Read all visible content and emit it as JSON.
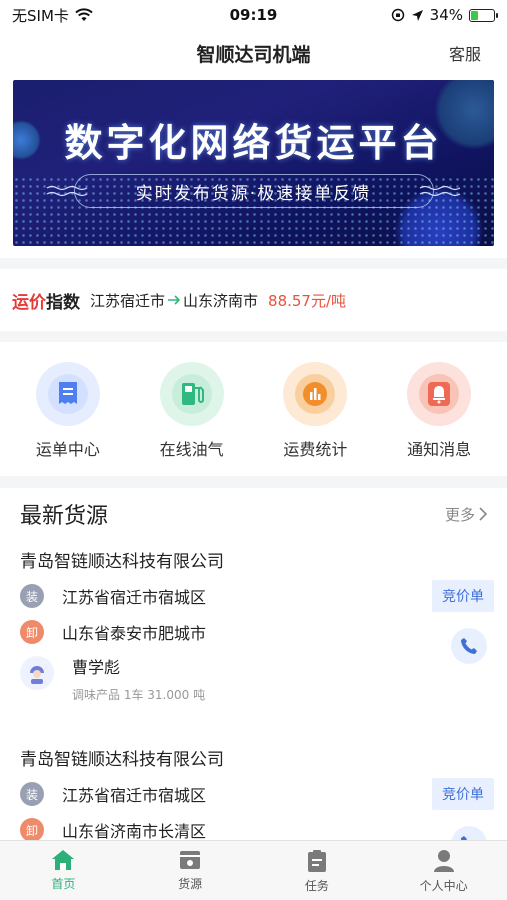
{
  "status_bar": {
    "carrier": "无SIM卡",
    "time": "09:19",
    "battery_percent": "34%",
    "battery_level": 0.34
  },
  "nav": {
    "title": "智顺达司机端",
    "service_label": "客服"
  },
  "banner": {
    "title": "数字化网络货运平台",
    "subtitle": "实时发布货源·极速接单反馈"
  },
  "price_index": {
    "logo_red": "运价",
    "logo_dark": "指数",
    "from": "江苏宿迁市",
    "to": "山东济南市",
    "price": "88.57元/吨"
  },
  "menu": {
    "items": [
      {
        "label": "运单中心",
        "icon": "waybill-icon",
        "color": "#4f7ef0",
        "bg": "#e6edff"
      },
      {
        "label": "在线油气",
        "icon": "fuel-pump-icon",
        "color": "#2fb880",
        "bg": "#dff5ea"
      },
      {
        "label": "运费统计",
        "icon": "bar-chart-icon",
        "color": "#f28e2b",
        "bg": "#fde9d4"
      },
      {
        "label": "通知消息",
        "icon": "bell-icon",
        "color": "#ee6a55",
        "bg": "#fde1dc"
      }
    ]
  },
  "latest": {
    "title": "最新货源",
    "more_label": "更多",
    "cargo": [
      {
        "company": "青岛智链顺达科技有限公司",
        "load_tag": "装",
        "load_addr": "江苏省宿迁市宿城区",
        "unload_tag": "卸",
        "unload_addr": "山东省泰安市肥城市",
        "badge": "竞价单",
        "contact": "曹学彪",
        "meta": "调味产品 1车 31.000 吨"
      },
      {
        "company": "青岛智链顺达科技有限公司",
        "load_tag": "装",
        "load_addr": "江苏省宿迁市宿城区",
        "unload_tag": "卸",
        "unload_addr": "山东省济南市长清区",
        "badge": "竞价单"
      }
    ]
  },
  "tabs": [
    {
      "label": "首页",
      "icon": "home-icon",
      "active": true
    },
    {
      "label": "货源",
      "icon": "cargo-icon",
      "active": false
    },
    {
      "label": "任务",
      "icon": "task-clipboard-icon",
      "active": false
    },
    {
      "label": "个人中心",
      "icon": "user-icon",
      "active": false
    }
  ],
  "colors": {
    "accent_green": "#2bb07a",
    "price_red": "#e6533b",
    "bid_blue": "#3f6fd8"
  }
}
